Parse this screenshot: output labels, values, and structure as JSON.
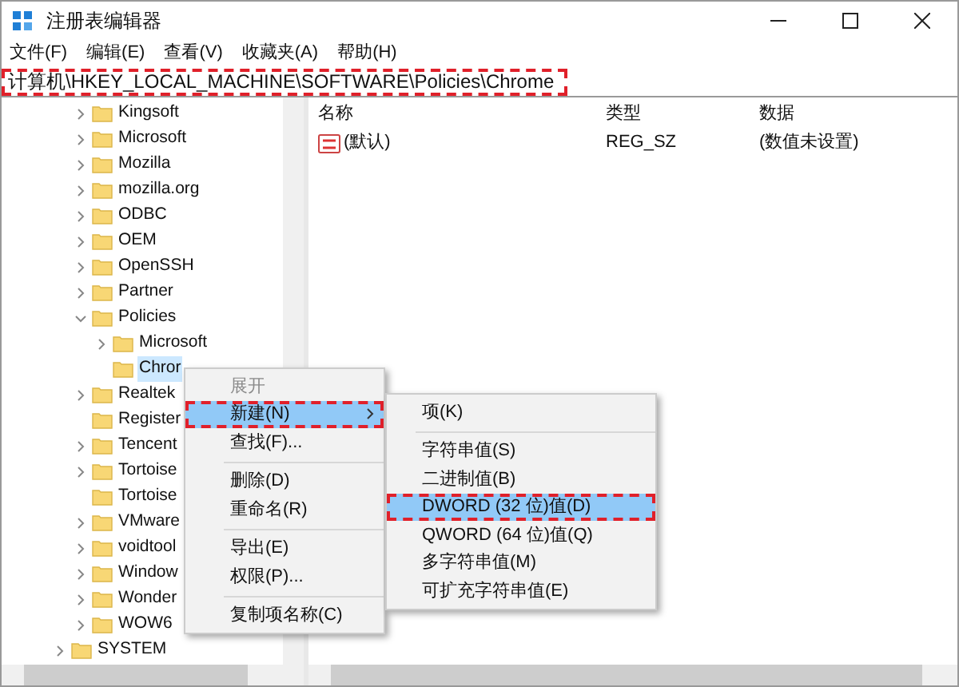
{
  "window": {
    "title": "注册表编辑器"
  },
  "menu_bar": [
    "文件(F)",
    "编辑(E)",
    "查看(V)",
    "收藏夹(A)",
    "帮助(H)"
  ],
  "address_bar": {
    "value": "计算机\\HKEY_LOCAL_MACHINE\\SOFTWARE\\Policies\\Chrome",
    "highlighted": true
  },
  "tree": [
    {
      "children": [
        {
          "label": "Kingsoft",
          "kind": "collapsed",
          "selected": false
        },
        {
          "label": "Microsoft",
          "kind": "collapsed",
          "selected": false
        },
        {
          "label": "Mozilla",
          "kind": "collapsed",
          "selected": false
        },
        {
          "label": "mozilla.org",
          "kind": "collapsed",
          "selected": false
        },
        {
          "label": "ODBC",
          "kind": "collapsed",
          "selected": false
        },
        {
          "label": "OEM",
          "kind": "collapsed",
          "selected": false
        },
        {
          "label": "OpenSSH",
          "kind": "collapsed",
          "selected": false
        },
        {
          "label": "Partner",
          "kind": "collapsed",
          "selected": false
        },
        {
          "label": "Policies",
          "kind": "expanded",
          "selected": false,
          "children": [
            {
              "label": "Microsoft",
              "kind": "collapsed",
              "selected": false
            },
            {
              "label": "Chror",
              "kind": "leaf",
              "selected": true
            }
          ]
        },
        {
          "label": "Realtek",
          "kind": "collapsed",
          "selected": false
        },
        {
          "label": "Register",
          "kind": "leaf",
          "selected": false
        },
        {
          "label": "Tencent",
          "kind": "collapsed",
          "selected": false
        },
        {
          "label": "Tortoise",
          "kind": "collapsed",
          "selected": false
        },
        {
          "label": "Tortoise",
          "kind": "leaf",
          "selected": false
        },
        {
          "label": "VMware",
          "kind": "collapsed",
          "selected": false
        },
        {
          "label": "voidtool",
          "kind": "collapsed",
          "selected": false
        },
        {
          "label": "Window",
          "kind": "collapsed",
          "selected": false
        },
        {
          "label": "Wonder",
          "kind": "collapsed",
          "selected": false
        },
        {
          "label": "WOW6",
          "kind": "collapsed",
          "selected": false
        }
      ]
    },
    {
      "label": "SYSTEM",
      "kind": "collapsed",
      "selected": false
    }
  ],
  "table": {
    "columns": [
      "名称",
      "类型",
      "数据"
    ],
    "rows": [
      {
        "name": "(默认)",
        "type": "REG_SZ",
        "data": "(数值未设置)"
      }
    ]
  },
  "context_menu": {
    "groups": [
      [
        {
          "label": "展开",
          "disabled": true,
          "selected": false,
          "highlighted": false,
          "submenu": false
        },
        {
          "label": "新建(N)",
          "disabled": false,
          "selected": true,
          "highlighted": true,
          "submenu": true
        },
        {
          "label": "查找(F)...",
          "disabled": false,
          "selected": false,
          "highlighted": false,
          "submenu": false
        }
      ],
      [
        {
          "label": "删除(D)",
          "disabled": false,
          "selected": false,
          "highlighted": false,
          "submenu": false
        },
        {
          "label": "重命名(R)",
          "disabled": false,
          "selected": false,
          "highlighted": false,
          "submenu": false
        }
      ],
      [
        {
          "label": "导出(E)",
          "disabled": false,
          "selected": false,
          "highlighted": false,
          "submenu": false
        },
        {
          "label": "权限(P)...",
          "disabled": false,
          "selected": false,
          "highlighted": false,
          "submenu": false
        }
      ],
      [
        {
          "label": "复制项名称(C)",
          "disabled": false,
          "selected": false,
          "highlighted": false,
          "submenu": false
        }
      ]
    ]
  },
  "submenu": {
    "groups": [
      [
        {
          "label": "项(K)",
          "selected": false,
          "highlighted": false
        }
      ],
      [
        {
          "label": "字符串值(S)",
          "selected": false,
          "highlighted": false
        },
        {
          "label": "二进制值(B)",
          "selected": false,
          "highlighted": false
        },
        {
          "label": "DWORD (32 位)值(D)",
          "selected": true,
          "highlighted": true
        },
        {
          "label": "QWORD (64 位)值(Q)",
          "selected": false,
          "highlighted": false
        },
        {
          "label": "多字符串值(M)",
          "selected": false,
          "highlighted": false
        },
        {
          "label": "可扩充字符串值(E)",
          "selected": false,
          "highlighted": false
        }
      ]
    ]
  }
}
